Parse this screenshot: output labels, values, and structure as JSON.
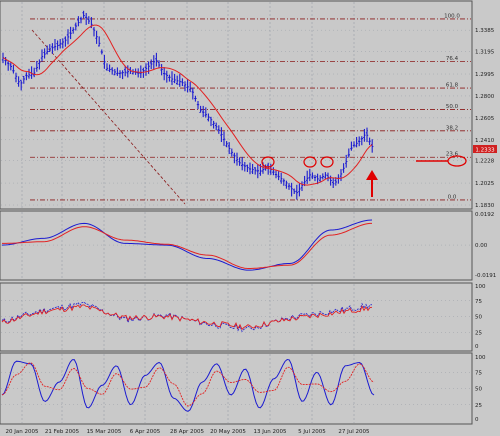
{
  "colors": {
    "background": "#c9c9c9",
    "grid": "#9aa0a8",
    "panel_border": "#555555",
    "price_bars": "#1b1bd0",
    "moving_average": "#e22222",
    "fib_lines": "#8b1a1a",
    "annotations": "#e00000",
    "current_price_box": "#d02020"
  },
  "main_panel": {
    "type": "bar",
    "y_ticks": [
      "1.3385",
      "1.3195",
      "1.2995",
      "1.2800",
      "1.2605",
      "1.2410",
      "1.2228",
      "1.2025",
      "1.1830"
    ],
    "current_price": "1.2333",
    "fib_levels": [
      {
        "label": "100.0",
        "price": 1.3485
      },
      {
        "label": "76.4",
        "price": 1.3105
      },
      {
        "label": "61.8",
        "price": 1.287
      },
      {
        "label": "50.0",
        "price": 1.268
      },
      {
        "label": "38.2",
        "price": 1.249
      },
      {
        "label": "23.6",
        "price": 1.2255
      },
      {
        "label": "0.0",
        "price": 1.1875
      }
    ],
    "highlighted_level": "23.6"
  },
  "macd_panel": {
    "type": "line",
    "y_ticks": [
      "0.0192",
      "0.00",
      "-0.0191"
    ]
  },
  "rsi_panel": {
    "type": "line",
    "y_ticks": [
      "100",
      "75",
      "50",
      "25",
      "0"
    ]
  },
  "stoch_panel": {
    "type": "line",
    "y_ticks": [
      "100",
      "75",
      "50",
      "25",
      "0"
    ]
  },
  "x_axis": {
    "labels": [
      "20 Jan 2005",
      "21 Feb 2005",
      "15 Mar 2005",
      "6 Apr 2005",
      "28 Apr 2005",
      "20 May 2005",
      "13 Jun 2005",
      "5 Jul 2005",
      "27 Jul 2005"
    ]
  },
  "chart_data": [
    {
      "type": "bar",
      "description_series": "price OHLC bars with red moving average",
      "x": [
        "20 Jan 2005",
        "21 Feb 2005",
        "15 Mar 2005",
        "6 Apr 2005",
        "28 Apr 2005",
        "20 May 2005",
        "13 Jun 2005",
        "5 Jul 2005",
        "27 Jul 2005"
      ],
      "close_approx": [
        1.3,
        1.31,
        1.345,
        1.295,
        1.29,
        1.26,
        1.215,
        1.195,
        1.233
      ],
      "ma_approx": [
        1.302,
        1.305,
        1.32,
        1.3,
        1.283,
        1.255,
        1.23,
        1.205,
        1.222
      ],
      "ylim": [
        1.183,
        1.36
      ]
    },
    {
      "type": "line",
      "series": [
        {
          "name": "",
          "values": [
            0.0,
            0.004,
            0.013,
            0.001,
            0.0,
            -0.008,
            -0.015,
            -0.011,
            0.009,
            0.015
          ]
        },
        {
          "name": "",
          "values": [
            0.001,
            0.002,
            0.011,
            0.003,
            0.0005,
            -0.006,
            -0.014,
            -0.012,
            0.006,
            0.013
          ]
        }
      ],
      "ylim": [
        -0.0191,
        0.0192
      ]
    },
    {
      "type": "line",
      "series": [
        {
          "name": "",
          "values": [
            42,
            60,
            70,
            45,
            52,
            38,
            30,
            48,
            58,
            68
          ]
        },
        {
          "name": "",
          "values": [
            40,
            58,
            66,
            48,
            50,
            40,
            33,
            46,
            55,
            64
          ]
        }
      ],
      "ylim": [
        0,
        100
      ]
    },
    {
      "type": "line",
      "series": [
        {
          "name": "",
          "values": [
            30,
            95,
            20,
            90,
            15,
            85,
            20,
            80,
            25,
            92,
            40
          ]
        },
        {
          "name": "",
          "values": [
            35,
            88,
            28,
            84,
            22,
            80,
            28,
            74,
            30,
            86,
            50
          ]
        }
      ],
      "ylim": [
        0,
        100
      ]
    }
  ]
}
